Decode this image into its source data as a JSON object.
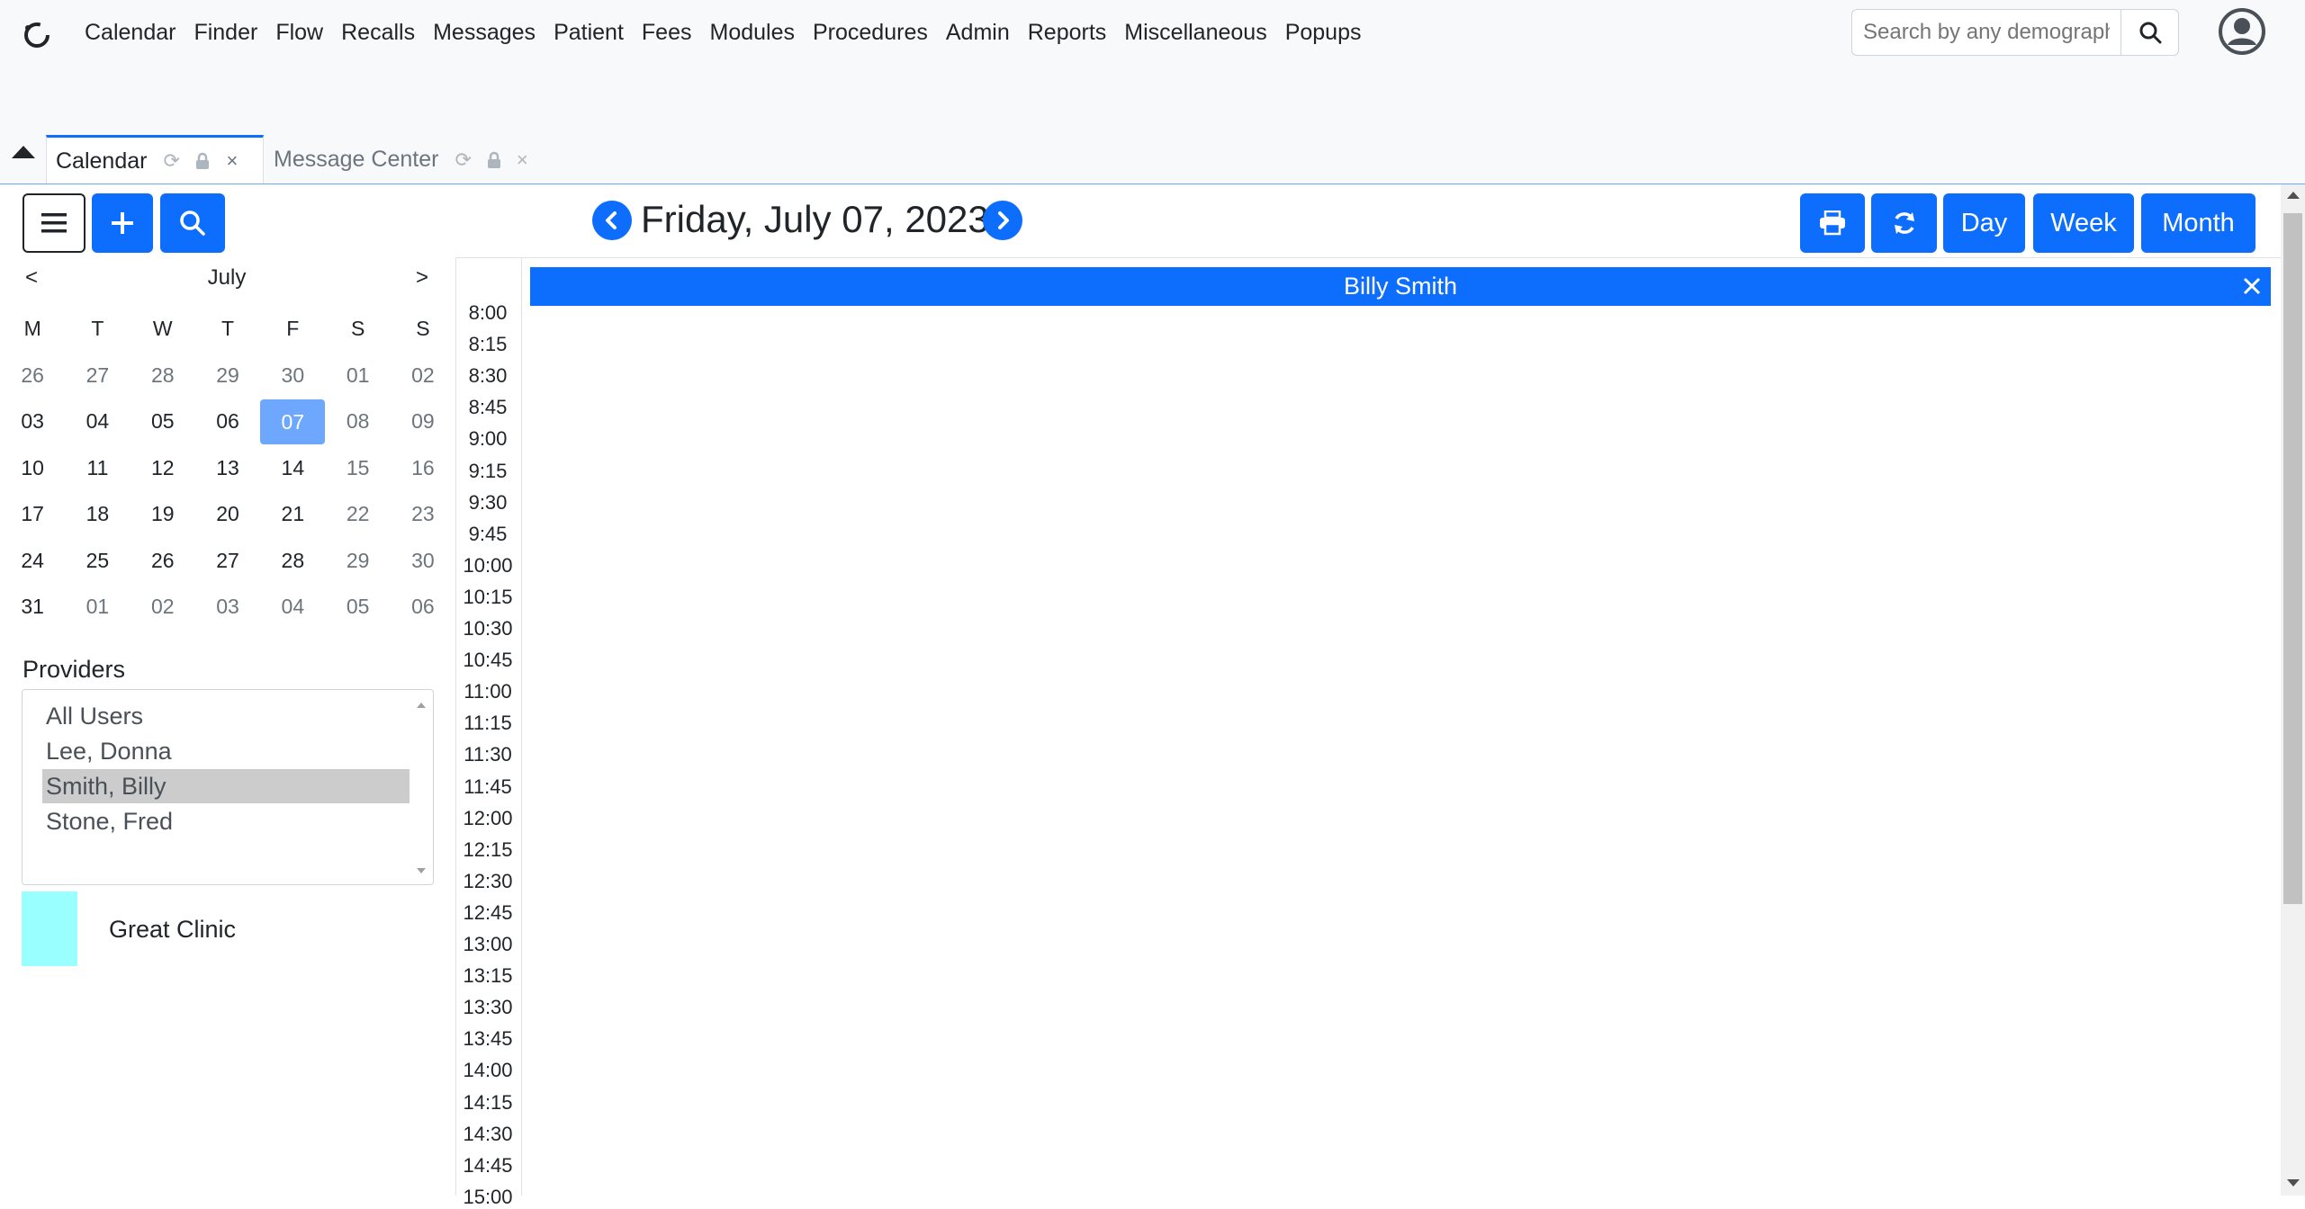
{
  "nav": {
    "menu": [
      "Calendar",
      "Finder",
      "Flow",
      "Recalls",
      "Messages",
      "Patient",
      "Fees",
      "Modules",
      "Procedures",
      "Admin",
      "Reports",
      "Miscellaneous",
      "Popups"
    ],
    "search": {
      "placeholder": "Search by any demographics"
    }
  },
  "tabs": [
    {
      "label": "Calendar",
      "active": true
    },
    {
      "label": "Message Center",
      "active": false
    }
  ],
  "toolbar": {
    "date_title": "Friday, July 07, 2023",
    "views": [
      "Day",
      "Week",
      "Month"
    ]
  },
  "mini_calendar": {
    "prev": "<",
    "next": ">",
    "month": "July",
    "weekdays": [
      "M",
      "T",
      "W",
      "T",
      "F",
      "S",
      "S"
    ],
    "weeks": [
      [
        "26",
        "27",
        "28",
        "29",
        "30",
        "01",
        "02"
      ],
      [
        "03",
        "04",
        "05",
        "06",
        "07",
        "08",
        "09"
      ],
      [
        "10",
        "11",
        "12",
        "13",
        "14",
        "15",
        "16"
      ],
      [
        "17",
        "18",
        "19",
        "20",
        "21",
        "22",
        "23"
      ],
      [
        "24",
        "25",
        "26",
        "27",
        "28",
        "29",
        "30"
      ],
      [
        "31",
        "01",
        "02",
        "03",
        "04",
        "05",
        "06"
      ]
    ],
    "selected": "07"
  },
  "providers": {
    "title": "Providers",
    "items": [
      "All Users",
      "Lee, Donna",
      "Smith, Billy",
      "Stone, Fred"
    ],
    "selected": "Smith, Billy"
  },
  "facility": {
    "name": "Great Clinic",
    "color": "#99ffff"
  },
  "day_view": {
    "provider": "Billy Smith",
    "times": [
      "8:00",
      "8:15",
      "8:30",
      "8:45",
      "9:00",
      "9:15",
      "9:30",
      "9:45",
      "10:00",
      "10:15",
      "10:30",
      "10:45",
      "11:00",
      "11:15",
      "11:30",
      "11:45",
      "12:00",
      "12:15",
      "12:30",
      "12:45",
      "13:00",
      "13:15",
      "13:30",
      "13:45",
      "14:00",
      "14:15",
      "14:30",
      "14:45",
      "15:00"
    ]
  },
  "colors": {
    "primary": "#0d6efd",
    "selected_day": "#6ea8fe",
    "nav_bg": "#f8f9fa"
  }
}
